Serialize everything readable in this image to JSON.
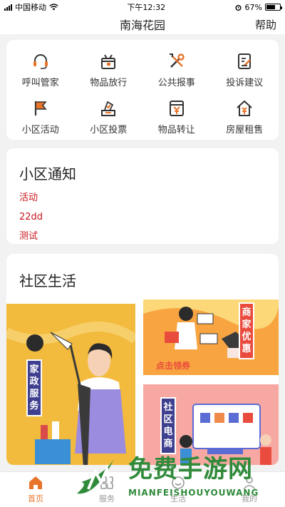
{
  "status_bar": {
    "carrier": "中国移动",
    "time": "下午12:32",
    "battery": "67%",
    "battery_level": 0.67
  },
  "nav": {
    "title": "南海花园",
    "help": "帮助"
  },
  "services": [
    {
      "label": "呼叫管家",
      "icon": "headset-icon"
    },
    {
      "label": "物品放行",
      "icon": "package-release-icon"
    },
    {
      "label": "公共报事",
      "icon": "tools-icon"
    },
    {
      "label": "投诉建议",
      "icon": "feedback-icon"
    },
    {
      "label": "小区活动",
      "icon": "flag-icon"
    },
    {
      "label": "小区投票",
      "icon": "ballot-icon"
    },
    {
      "label": "物品转让",
      "icon": "transfer-icon"
    },
    {
      "label": "房屋租售",
      "icon": "house-rent-icon"
    }
  ],
  "notices": {
    "title": "小区通知",
    "items": [
      "活动",
      "22dd",
      "测试"
    ]
  },
  "life": {
    "title": "社区生活",
    "tiles": [
      {
        "badge": "家政服务"
      },
      {
        "badge": "商家优惠",
        "caption": "点击领券"
      },
      {
        "badge": "社区电商"
      }
    ]
  },
  "tabs": [
    {
      "label": "首页",
      "active": true
    },
    {
      "label": "服务",
      "active": false
    },
    {
      "label": "生活",
      "active": false
    },
    {
      "label": "我的",
      "active": false
    }
  ],
  "watermark": {
    "cn": "免费手游网",
    "en": "MIANFEISHOUYOUWANG"
  },
  "colors": {
    "accent": "#e8742a",
    "notice": "#c8161d",
    "badge": "#3e3f8f"
  }
}
